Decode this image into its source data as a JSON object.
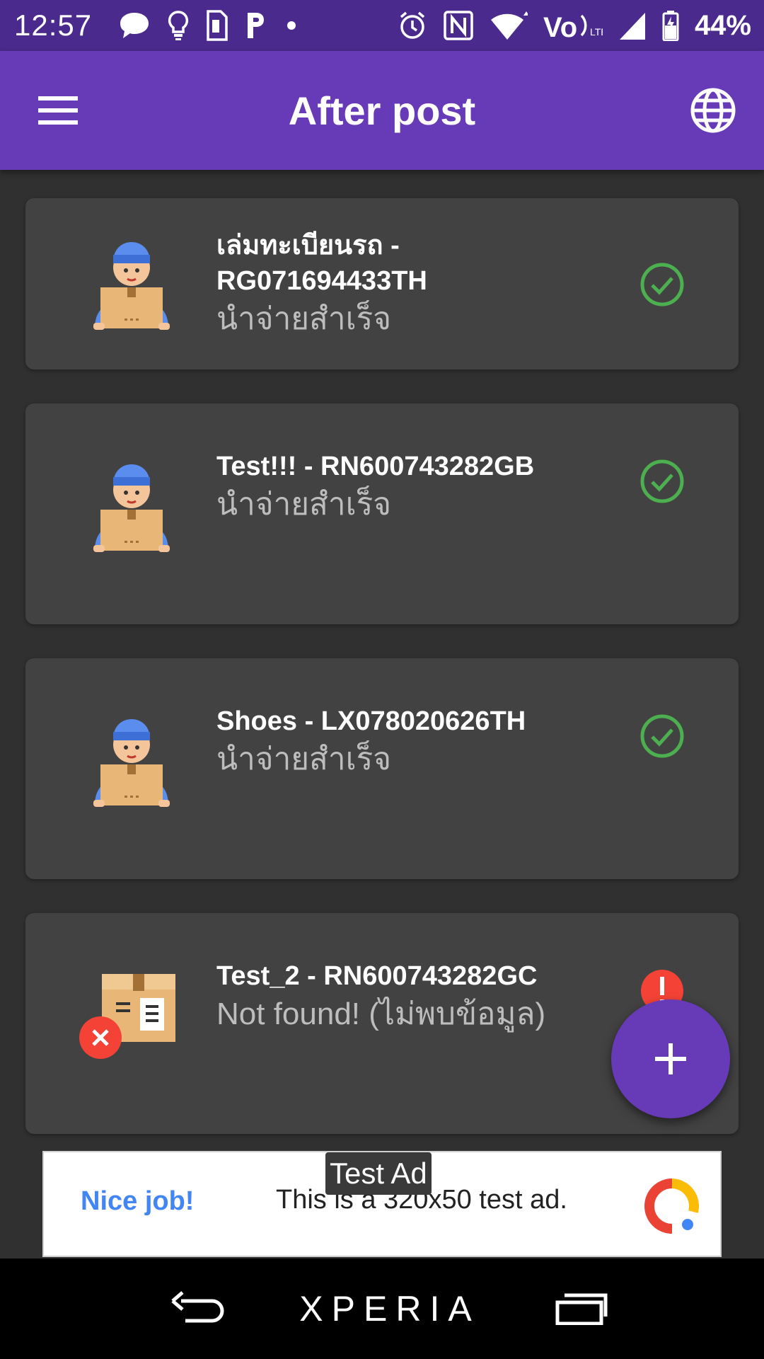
{
  "status_bar": {
    "time": "12:57",
    "battery": "44%",
    "left_icons": [
      "chat-bubble-icon",
      "lightbulb-icon",
      "sim-card-icon",
      "parking-icon",
      "dot-icon"
    ],
    "right_icons": [
      "alarm-icon",
      "nfc-icon",
      "wifi-icon",
      "volte-icon",
      "signal-icon",
      "battery-icon"
    ]
  },
  "app_bar": {
    "title": "After post",
    "menu_icon": "hamburger-menu-icon",
    "language_icon": "globe-icon"
  },
  "items": [
    {
      "title": "เล่มทะเบียนรถ - RG071694433TH",
      "status": "นำจ่ายสำเร็จ",
      "state": "delivered",
      "avatar": "courier-icon"
    },
    {
      "title": "Test!!! - RN600743282GB",
      "status": "นำจ่ายสำเร็จ",
      "state": "delivered",
      "avatar": "courier-icon"
    },
    {
      "title": "Shoes - LX078020626TH",
      "status": "นำจ่ายสำเร็จ",
      "state": "delivered",
      "avatar": "courier-icon"
    },
    {
      "title": "Test_2 - RN600743282GC",
      "status": "Not found! (ไม่พบข้อมูล)",
      "state": "error",
      "avatar": "box-error-icon"
    }
  ],
  "fab": {
    "icon": "plus-icon"
  },
  "ad": {
    "tag": "Test Ad",
    "headline": "Nice job!",
    "body": "This is a 320x50 test ad."
  },
  "nav_bar": {
    "brand": "XPERIA",
    "icons": [
      "back-icon",
      "recents-icon"
    ]
  },
  "colors": {
    "primary": "#673ab7",
    "status_bar": "#4a2a8c",
    "background": "#303030",
    "card": "#424242",
    "success": "#4caf50",
    "error": "#f44336"
  }
}
